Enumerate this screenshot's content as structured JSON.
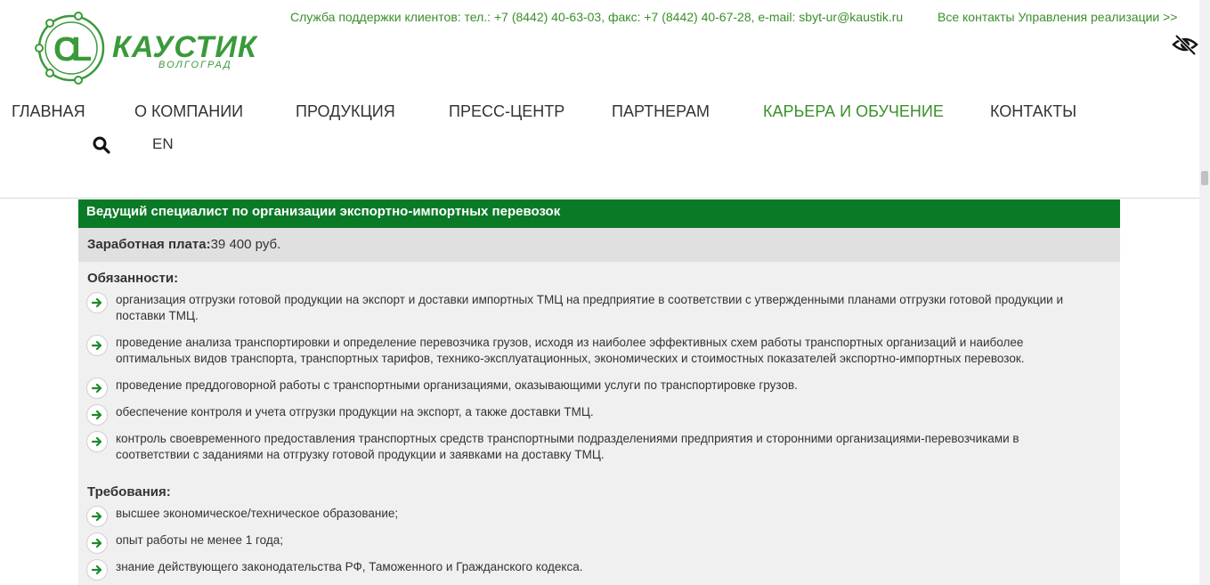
{
  "brand": {
    "name": "КАУСТИК",
    "city": "ВОЛГОГРАД",
    "color": "#3a9a3a"
  },
  "topbar": {
    "support": "Служба поддержки клиентов: тел.: +7 (8442) 40-63-03, факс: +7 (8442) 40-67-28, e-mail: sbyt-ur@kaustik.ru",
    "all_contacts": "Все контакты Управления реализации >>",
    "accessibility_icon": "eye-slash-icon"
  },
  "nav": {
    "items": [
      {
        "label": "ГЛАВНАЯ"
      },
      {
        "label": "О КОМПАНИИ"
      },
      {
        "label": "ПРОДУКЦИЯ"
      },
      {
        "label": "ПРЕСС-ЦЕНТР"
      },
      {
        "label": "ПАРТНЕРАМ"
      },
      {
        "label": "КАРЬЕРА И ОБУЧЕНИЕ"
      },
      {
        "label": "КОНТАКТЫ"
      }
    ],
    "active_index": 5,
    "lang": "EN",
    "accent_color": "#3a8f2a"
  },
  "vacancy": {
    "title": "Ведущий специалист по организации экспортно-импортных перевозок",
    "salary_label": "Заработная плата:",
    "salary_value": "39 400 руб.",
    "header_color": "#0b7a27",
    "duties_title": "Обязанности:",
    "duties": [
      "организация отгрузки готовой продукции на экспорт и доставки импортных ТМЦ на предприятие в соответствии с утвержденными планами отгрузки готовой продукции и поставки ТМЦ.",
      "проведение анализа транспортировки и определение перевозчика грузов, исходя из наиболее эффективных схем работы транспортных организаций и наиболее оптимальных видов транспорта, транспортных тарифов, технико-эксплуатационных, экономических и стоимостных показателей экспортно-импортных перевозок.",
      "проведение преддоговорной работы с транспортными организациями, оказывающими услуги по транспортировке грузов.",
      "обеспечение контроля и учета отгрузки продукции на экспорт, а также доставки ТМЦ.",
      "контроль своевременного предоставления транспортных средств транспортными подразделениями предприятия и сторонними организациями-перевозчиками в соответствии с заданиями на отгрузку готовой продукции и заявками на доставку ТМЦ."
    ],
    "requirements_title": "Требования:",
    "requirements": [
      "высшее экономическое/техническое образование;",
      "опыт работы не менее 1 года;",
      "знание действующего законодательства РФ, Таможенного и Гражданского кодекса."
    ]
  }
}
